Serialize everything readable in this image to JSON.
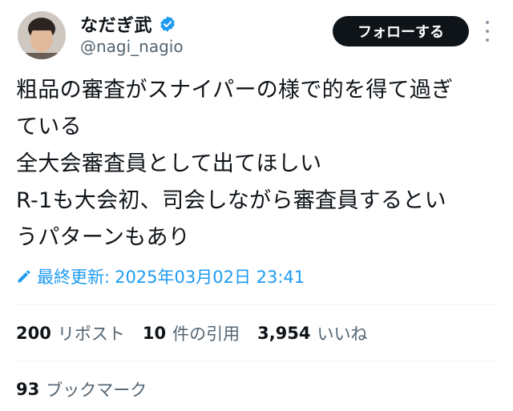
{
  "user": {
    "display_name": "なだぎ武",
    "handle": "@nagi_nagio",
    "verified_color": "#1d9bf0"
  },
  "actions": {
    "follow_label": "フォローする"
  },
  "tweet": {
    "lines": [
      "粗品の審査がスナイパーの様で的を得て過ぎ",
      "ている",
      "全大会審査員として出てほしい",
      "R-1も大会初、司会しながら審査員するとい",
      "うパターンもあり"
    ]
  },
  "edited": {
    "label": "最終更新:",
    "timestamp": "2025年03月02日 23:41"
  },
  "stats": {
    "reposts_count": "200",
    "reposts_label": "リポスト",
    "quotes_count": "10",
    "quotes_label": "件の引用",
    "likes_count": "3,954",
    "likes_label": "いいね"
  },
  "bookmarks": {
    "count": "93",
    "label": "ブックマーク"
  }
}
